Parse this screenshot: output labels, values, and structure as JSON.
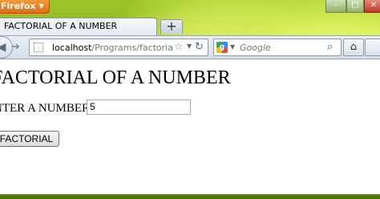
{
  "browser": {
    "menu_button": "Firefox",
    "tab_title": "FACTORIAL OF A NUMBER",
    "url_host": "localhost",
    "url_path": "/Programs/factorial.p",
    "search_placeholder": "Google"
  },
  "page": {
    "heading": "FACTORIAL OF A NUMBER",
    "input_label": "NTER A NUMBER:",
    "input_value": "5",
    "button_label": "FACTORIAL"
  }
}
